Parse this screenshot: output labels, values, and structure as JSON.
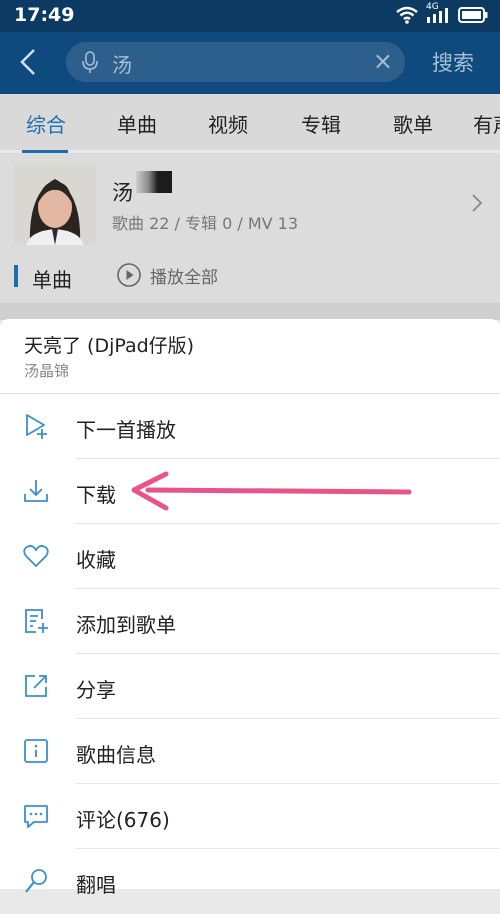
{
  "status": {
    "time": "17:49",
    "network": "4G"
  },
  "search": {
    "query": "汤",
    "button": "搜索"
  },
  "tabs": [
    "综合",
    "单曲",
    "视频",
    "专辑",
    "歌单",
    "有声"
  ],
  "artist": {
    "name": "汤",
    "stats": "歌曲 22 / 专辑 0 / MV 13"
  },
  "songs": {
    "title": "单曲",
    "play_all": "播放全部"
  },
  "sheet": {
    "title": "天亮了 (DjPad仔版)",
    "artist": "汤晶锦",
    "items": [
      {
        "label": "下一首播放",
        "icon": "play-next-icon"
      },
      {
        "label": "下载",
        "icon": "download-icon"
      },
      {
        "label": "收藏",
        "icon": "heart-icon"
      },
      {
        "label": "添加到歌单",
        "icon": "add-to-playlist-icon"
      },
      {
        "label": "分享",
        "icon": "share-icon"
      },
      {
        "label": "歌曲信息",
        "icon": "info-icon"
      },
      {
        "label": "评论(676)",
        "icon": "comment-icon"
      },
      {
        "label": "翻唱",
        "icon": "microphone-icon"
      }
    ]
  },
  "colors": {
    "accent": "#1f6fb0",
    "annotation": "#e8538a",
    "appbar": "#0f4a7f"
  }
}
